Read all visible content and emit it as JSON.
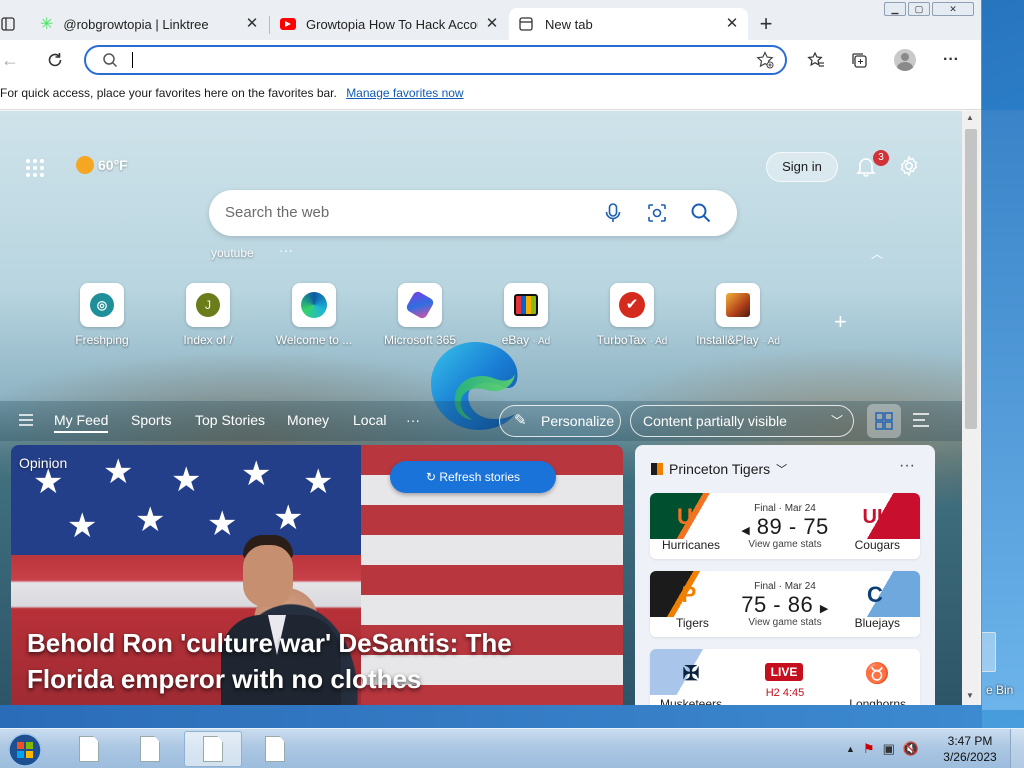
{
  "tabs": [
    {
      "label": "@robgrowtopia | Linktree",
      "icon": "linktree-icon"
    },
    {
      "label": "Growtopia How To Hack Account",
      "icon": "youtube-icon"
    },
    {
      "label": "New tab",
      "icon": "newtab-icon"
    }
  ],
  "address_bar": {
    "value": ""
  },
  "favorites_bar": {
    "message": "For quick access, place your favorites here on the favorites bar.",
    "link": "Manage favorites now"
  },
  "ntp": {
    "weather": "60°F",
    "sign_in": "Sign in",
    "notification_count": "3",
    "search_placeholder": "Search the web",
    "recent_search": "youtube",
    "quick_links": [
      {
        "name": "Freshping",
        "ad": ""
      },
      {
        "name": "Index of /",
        "ad": ""
      },
      {
        "name": "Welcome to ...",
        "ad": ""
      },
      {
        "name": "Microsoft 365",
        "ad": ""
      },
      {
        "name": "eBay",
        "ad": "· Ad"
      },
      {
        "name": "TurboTax",
        "ad": "· Ad"
      },
      {
        "name": "Install&Play",
        "ad": "· Ad"
      }
    ],
    "feed_tabs": [
      "My Feed",
      "Sports",
      "Top Stories",
      "Money",
      "Local"
    ],
    "more": "···",
    "personalize": "Personalize",
    "content_visibility": "Content partially visible",
    "hero": {
      "tag": "Opinion",
      "title": "Behold Ron 'culture war' DeSantis: The Florida emperor with no clothes"
    },
    "refresh": "Refresh stories",
    "sports": {
      "team": "Princeton Tigers",
      "games": [
        {
          "status": "Final · Mar 24",
          "score": "89 - 75",
          "stats": "View game stats",
          "home": "Hurricanes",
          "away": "Cougars",
          "home_color": "#005030",
          "away_color": "#c8102e"
        },
        {
          "status": "Final · Mar 24",
          "score": "75 - 86",
          "stats": "View game stats",
          "home": "Tigers",
          "away": "Bluejays",
          "home_color": "#1b1b1b",
          "away_color": "#0b5fa5"
        },
        {
          "status": "LIVE",
          "clock": "H2 4:45",
          "home": "Musketeers",
          "away": "Longhorns",
          "home_color": "#0c2340",
          "away_color": "#bf5700"
        }
      ]
    }
  },
  "desktop": {
    "recycle_bin": "e Bin"
  },
  "taskbar": {
    "time": "3:47 PM",
    "date": "3/26/2023"
  }
}
